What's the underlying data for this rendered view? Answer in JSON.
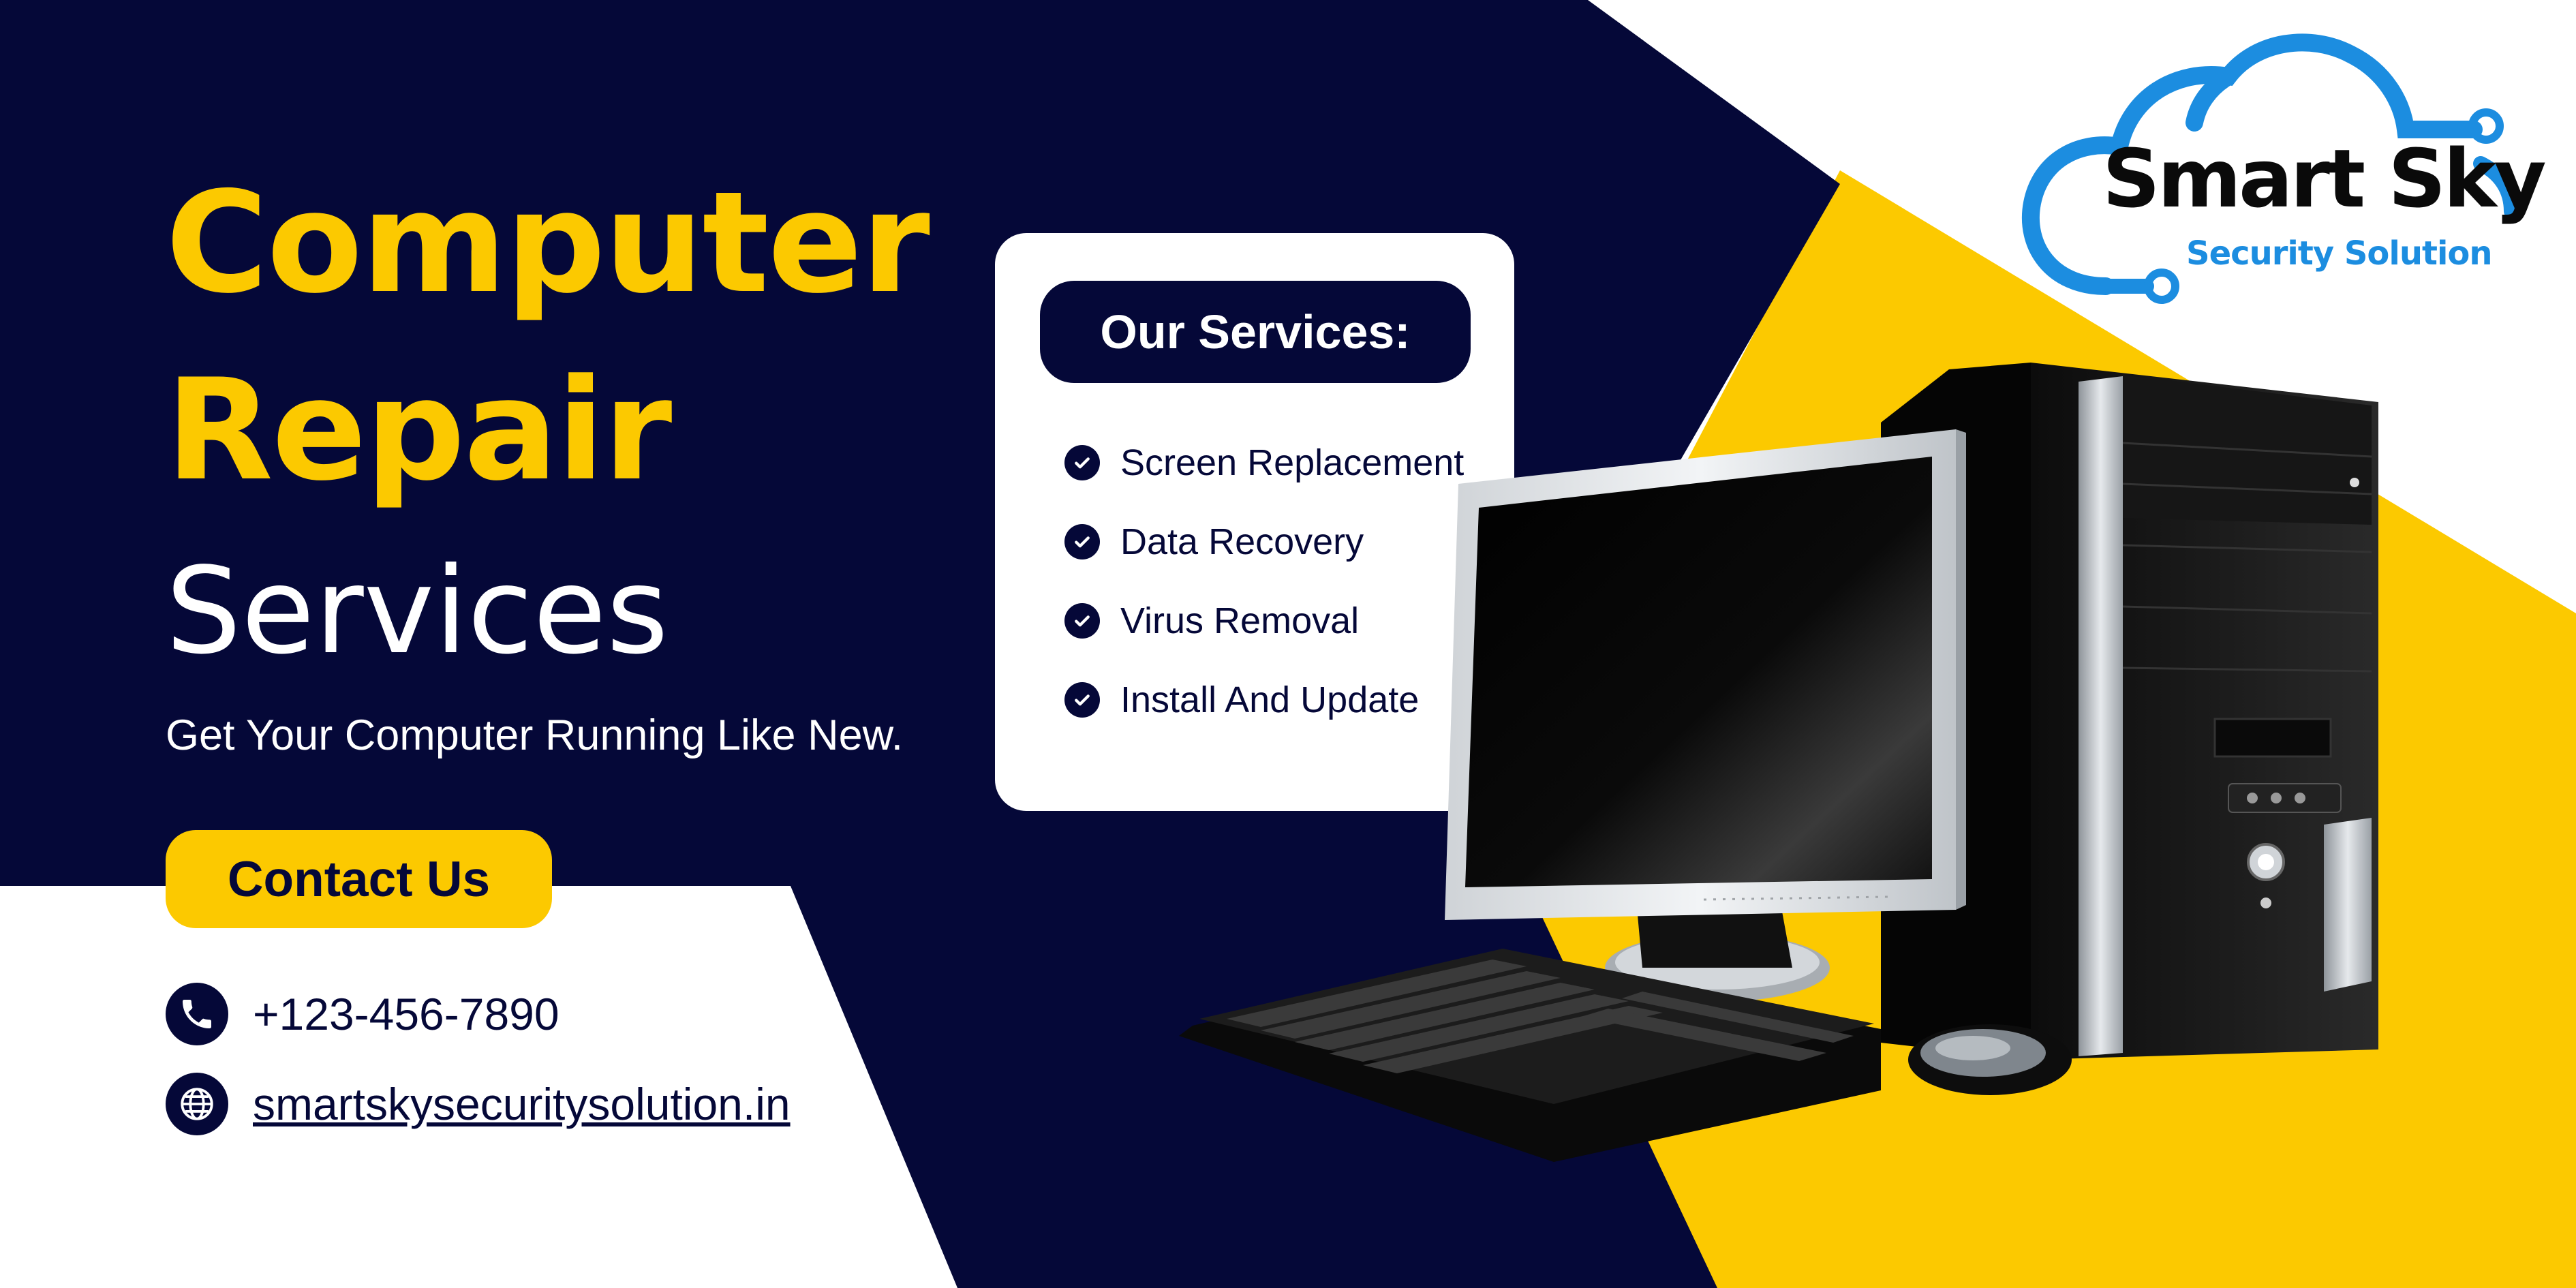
{
  "headline": {
    "line1": "Computer",
    "line2": "Repair",
    "line3": "Services"
  },
  "tagline": "Get Your Computer Running Like New.",
  "contact_button": "Contact Us",
  "contact": {
    "phone": "+123-456-7890",
    "website": "smartskysecuritysolution.in"
  },
  "services": {
    "heading": "Our Services:",
    "items": [
      {
        "label": "Screen Replacement"
      },
      {
        "label": "Data Recovery"
      },
      {
        "label": "Virus Removal"
      },
      {
        "label": "Install And Update"
      }
    ]
  },
  "logo": {
    "title": "Smart Sky",
    "subtitle": "Security Solution"
  },
  "icons": {
    "phone": "phone-icon",
    "globe": "globe-icon",
    "check": "check-circle-icon",
    "cloud": "cloud-logo-icon"
  },
  "colors": {
    "navy": "#050838",
    "yellow": "#fcc900",
    "white": "#ffffff",
    "logo_blue": "#1c8de0"
  }
}
